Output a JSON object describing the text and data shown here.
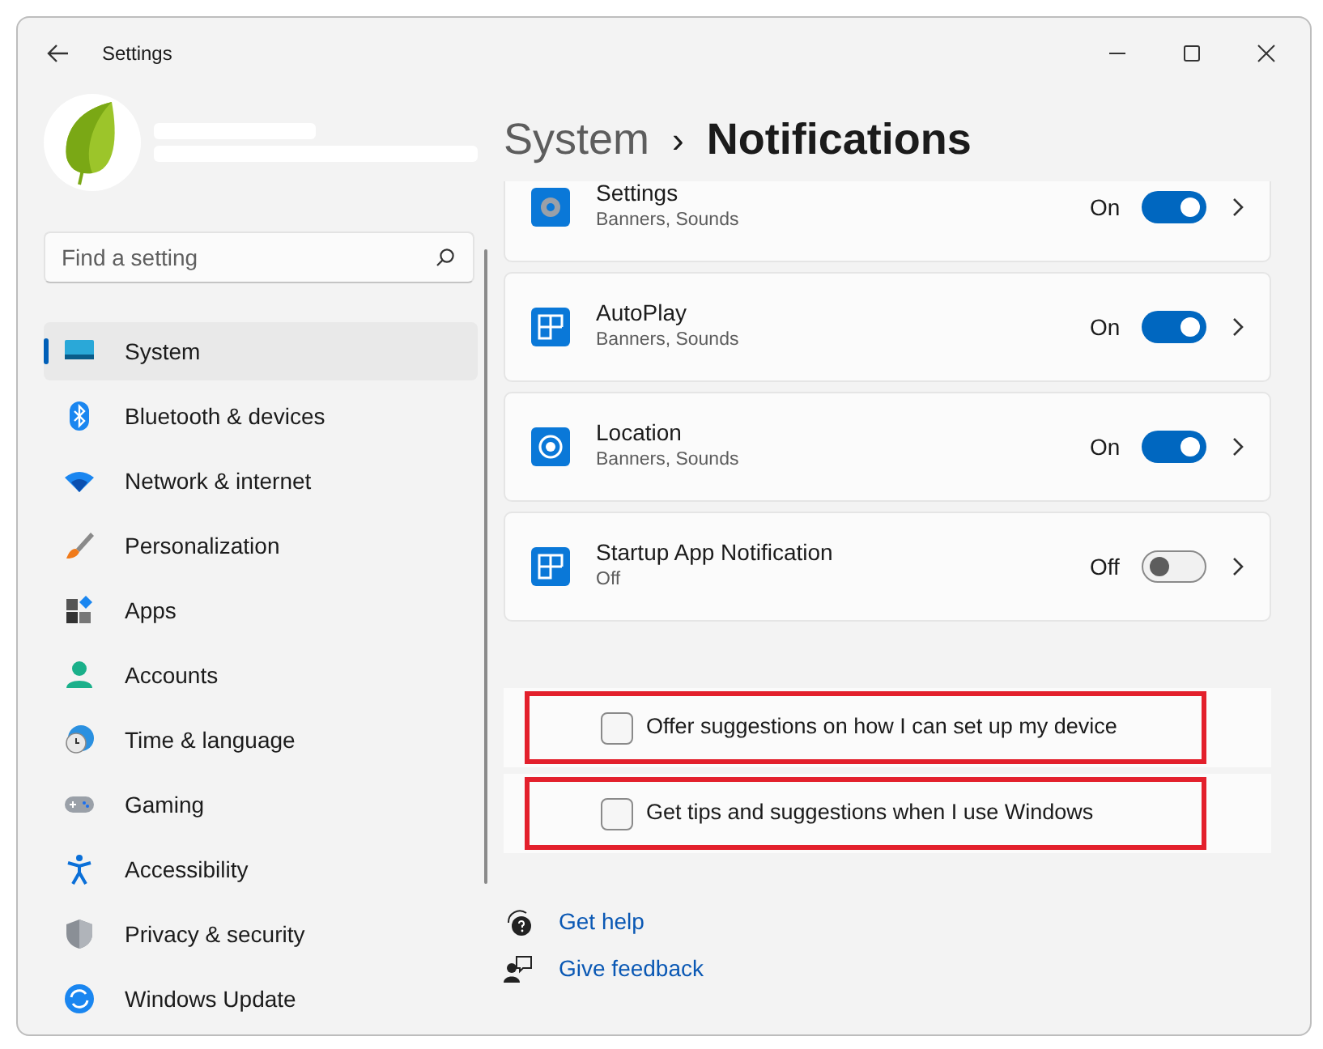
{
  "window": {
    "title": "Settings"
  },
  "search": {
    "placeholder": "Find a setting"
  },
  "sidebar": {
    "items": [
      {
        "label": "System",
        "kind": "system",
        "selected": true
      },
      {
        "label": "Bluetooth & devices",
        "kind": "bluetooth",
        "selected": false
      },
      {
        "label": "Network & internet",
        "kind": "wifi",
        "selected": false
      },
      {
        "label": "Personalization",
        "kind": "brush",
        "selected": false
      },
      {
        "label": "Apps",
        "kind": "apps",
        "selected": false
      },
      {
        "label": "Accounts",
        "kind": "person",
        "selected": false
      },
      {
        "label": "Time & language",
        "kind": "clock",
        "selected": false
      },
      {
        "label": "Gaming",
        "kind": "gamepad",
        "selected": false
      },
      {
        "label": "Accessibility",
        "kind": "access",
        "selected": false
      },
      {
        "label": "Privacy & security",
        "kind": "shield",
        "selected": false
      },
      {
        "label": "Windows Update",
        "kind": "update",
        "selected": false
      }
    ]
  },
  "breadcrumb": {
    "parent": "System",
    "separator": "›",
    "current": "Notifications"
  },
  "apps": [
    {
      "name": "Settings",
      "detail": "Banners, Sounds",
      "kind": "gear",
      "state": "On",
      "on": true
    },
    {
      "name": "AutoPlay",
      "detail": "Banners, Sounds",
      "kind": "grid",
      "state": "On",
      "on": true
    },
    {
      "name": "Location",
      "detail": "Banners, Sounds",
      "kind": "target",
      "state": "On",
      "on": true
    },
    {
      "name": "Startup App Notification",
      "detail": "Off",
      "kind": "grid",
      "state": "Off",
      "on": false
    }
  ],
  "options": [
    {
      "label": "Offer suggestions on how I can set up my device",
      "checked": false,
      "highlighted": true
    },
    {
      "label": "Get tips and suggestions when I use Windows",
      "checked": false,
      "highlighted": true
    }
  ],
  "links": [
    {
      "label": "Get help",
      "kind": "help"
    },
    {
      "label": "Give feedback",
      "kind": "feedback"
    }
  ]
}
